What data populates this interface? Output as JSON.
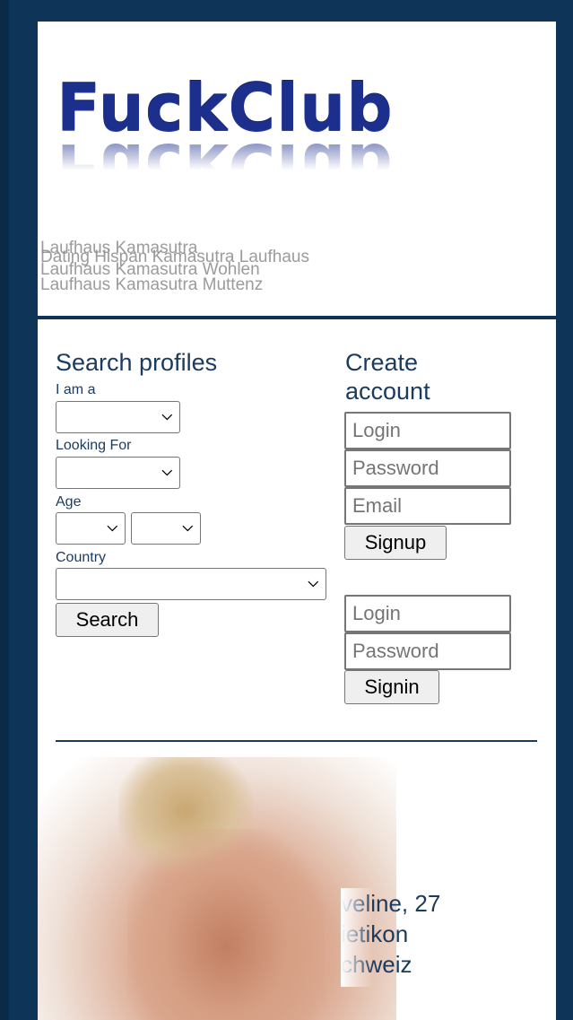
{
  "brand": {
    "logo": "FuckClub"
  },
  "header_ticker": [
    "Laufhaus Kamasutra",
    "Dating Hispan Kamasutra Laufhaus",
    "Laufhaus Kamasutra Wohlen",
    "Laufhaus Kamasutra Muttenz"
  ],
  "search": {
    "title": "Search profiles",
    "i_am_label": "I am a",
    "i_am_value": "",
    "looking_for_label": "Looking For",
    "looking_for_value": "",
    "age_label": "Age",
    "age_from_value": "",
    "age_to_value": "",
    "country_label": "Country",
    "country_value": "",
    "submit_label": "Search"
  },
  "signup": {
    "title": "Create account",
    "login_placeholder": "Login",
    "password_placeholder": "Password",
    "email_placeholder": "Email",
    "submit_label": "Signup"
  },
  "signin": {
    "login_placeholder": "Login",
    "password_placeholder": "Password",
    "submit_label": "Signin"
  },
  "profile_teaser": {
    "name_age": "veline, 27",
    "city": "ietikon",
    "country": "chweiz"
  },
  "colors": {
    "frame": "#0e3457",
    "heading": "#1a3a5e",
    "logo": "#1d2f8c"
  }
}
